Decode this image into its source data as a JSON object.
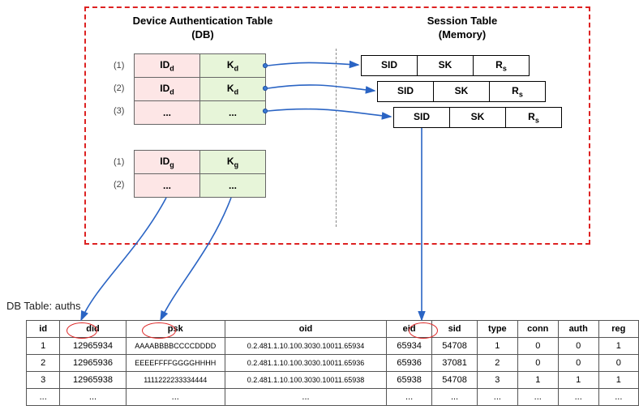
{
  "diagram": {
    "auth_title_line1": "Device Authentication Table",
    "auth_title_line2": "(DB)",
    "sess_title_line1": "Session Table",
    "sess_title_line2": "(Memory)",
    "auth_table_d": {
      "rows": [
        "(1)",
        "(2)",
        "(3)"
      ],
      "cells": [
        [
          "ID",
          "d",
          "K",
          "d"
        ],
        [
          "ID",
          "d",
          "K",
          "d"
        ],
        [
          "...",
          "",
          "...",
          ""
        ]
      ]
    },
    "auth_table_g": {
      "rows": [
        "(1)",
        "(2)"
      ],
      "cells": [
        [
          "ID",
          "g",
          "K",
          "g"
        ],
        [
          "...",
          "",
          "...",
          ""
        ]
      ]
    },
    "sess_headers": [
      "SID",
      "SK",
      "R",
      "s"
    ],
    "db_label": "DB Table: auths",
    "big_headers": [
      "id",
      "did",
      "psk",
      "oid",
      "eid",
      "sid",
      "type",
      "conn",
      "auth",
      "reg"
    ],
    "big_rows": [
      [
        "1",
        "12965934",
        "AAAABBBBCCCCDDDD",
        "0.2.481.1.10.100.3030.10011.65934",
        "65934",
        "54708",
        "1",
        "0",
        "0",
        "1"
      ],
      [
        "2",
        "12965936",
        "EEEEFFFFGGGGHHHH",
        "0.2.481.1.10.100.3030.10011.65936",
        "65936",
        "37081",
        "2",
        "0",
        "0",
        "0"
      ],
      [
        "3",
        "12965938",
        "1111222233334444",
        "0.2.481.1.10.100.3030.10011.65938",
        "65938",
        "54708",
        "3",
        "1",
        "1",
        "1"
      ],
      [
        "...",
        "...",
        "...",
        "...",
        "...",
        "...",
        "...",
        "...",
        "...",
        "..."
      ]
    ]
  }
}
